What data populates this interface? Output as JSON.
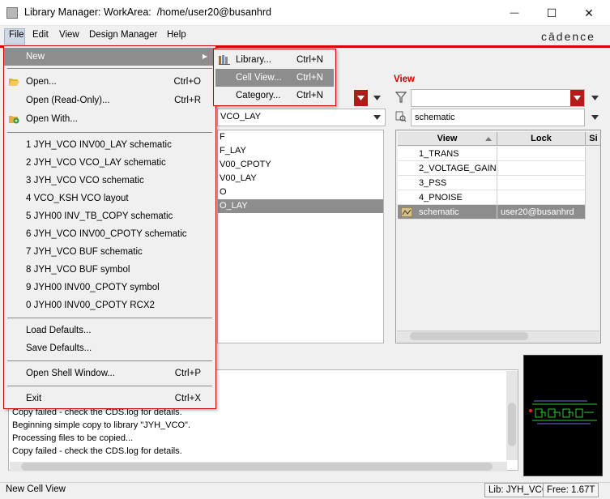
{
  "window": {
    "title": "Library Manager: WorkArea:  /home/user20@busanhrd",
    "min_glyph": "—",
    "max_glyph": "☐",
    "close_glyph": "✕"
  },
  "menubar": {
    "items": [
      "File",
      "Edit",
      "View",
      "Design Manager",
      "Help"
    ],
    "brand": "cādence"
  },
  "file_menu": {
    "new": "New",
    "new_arrow": "▶",
    "open": "Open...",
    "open_sc": "Ctrl+O",
    "open_ro": "Open (Read-Only)...",
    "open_ro_sc": "Ctrl+R",
    "open_with": "Open With...",
    "recent": [
      "1 JYH_VCO  INV00_LAY  schematic",
      "2 JYH_VCO  VCO_LAY  schematic",
      "3 JYH_VCO  VCO  schematic",
      "4 VCO_KSH  VCO  layout",
      "5 JYH00  INV_TB_COPY  schematic",
      "6 JYH_VCO  INV00_CPOTY  schematic",
      "7 JYH_VCO  BUF  schematic",
      "8 JYH_VCO  BUF  symbol",
      "9 JYH00  INV00_CPOTY  symbol",
      "0 JYH00  INV00_CPOTY  RCX2"
    ],
    "load_defaults": "Load Defaults...",
    "save_defaults": "Save Defaults...",
    "open_shell": "Open Shell Window...",
    "open_shell_sc": "Ctrl+P",
    "exit": "Exit",
    "exit_sc": "Ctrl+X"
  },
  "new_submenu": [
    {
      "label": "Library...",
      "shortcut": "Ctrl+N"
    },
    {
      "label": "Cell View...",
      "shortcut": "Ctrl+N"
    },
    {
      "label": "Category...",
      "shortcut": "Ctrl+N"
    }
  ],
  "cell_panel": {
    "search_value": "VCO_LAY",
    "visible_rows": [
      "F",
      "F_LAY",
      "V00_CPOTY",
      "V00_LAY",
      "O",
      "O_LAY"
    ],
    "selected_row": "O_LAY"
  },
  "view_panel": {
    "label": "View",
    "search_value": "schematic",
    "columns": [
      "View",
      "Lock",
      "Si"
    ],
    "rows": [
      {
        "view": "1_TRANS",
        "lock": ""
      },
      {
        "view": "2_VOLTAGE_GAIN",
        "lock": ""
      },
      {
        "view": "3_PSS",
        "lock": ""
      },
      {
        "view": "4_PNOISE",
        "lock": ""
      },
      {
        "view": "schematic",
        "lock": "user20@busanhrd"
      }
    ],
    "selected_view": "schematic"
  },
  "log": {
    "lines": [
      "Copy failed - check the CDS.log for details.",
      "Beginning simple copy to library \"JYH_VCO\".",
      "Processing files to be copied...",
      "Copy failed - check the CDS.log for details."
    ]
  },
  "status": {
    "message": "New Cell View",
    "lib": "Lib: JYH_VCO",
    "free": "Free: 1.67T"
  },
  "colors": {
    "accent_red": "#cc0000",
    "selection_gray": "#8d8d8d"
  }
}
